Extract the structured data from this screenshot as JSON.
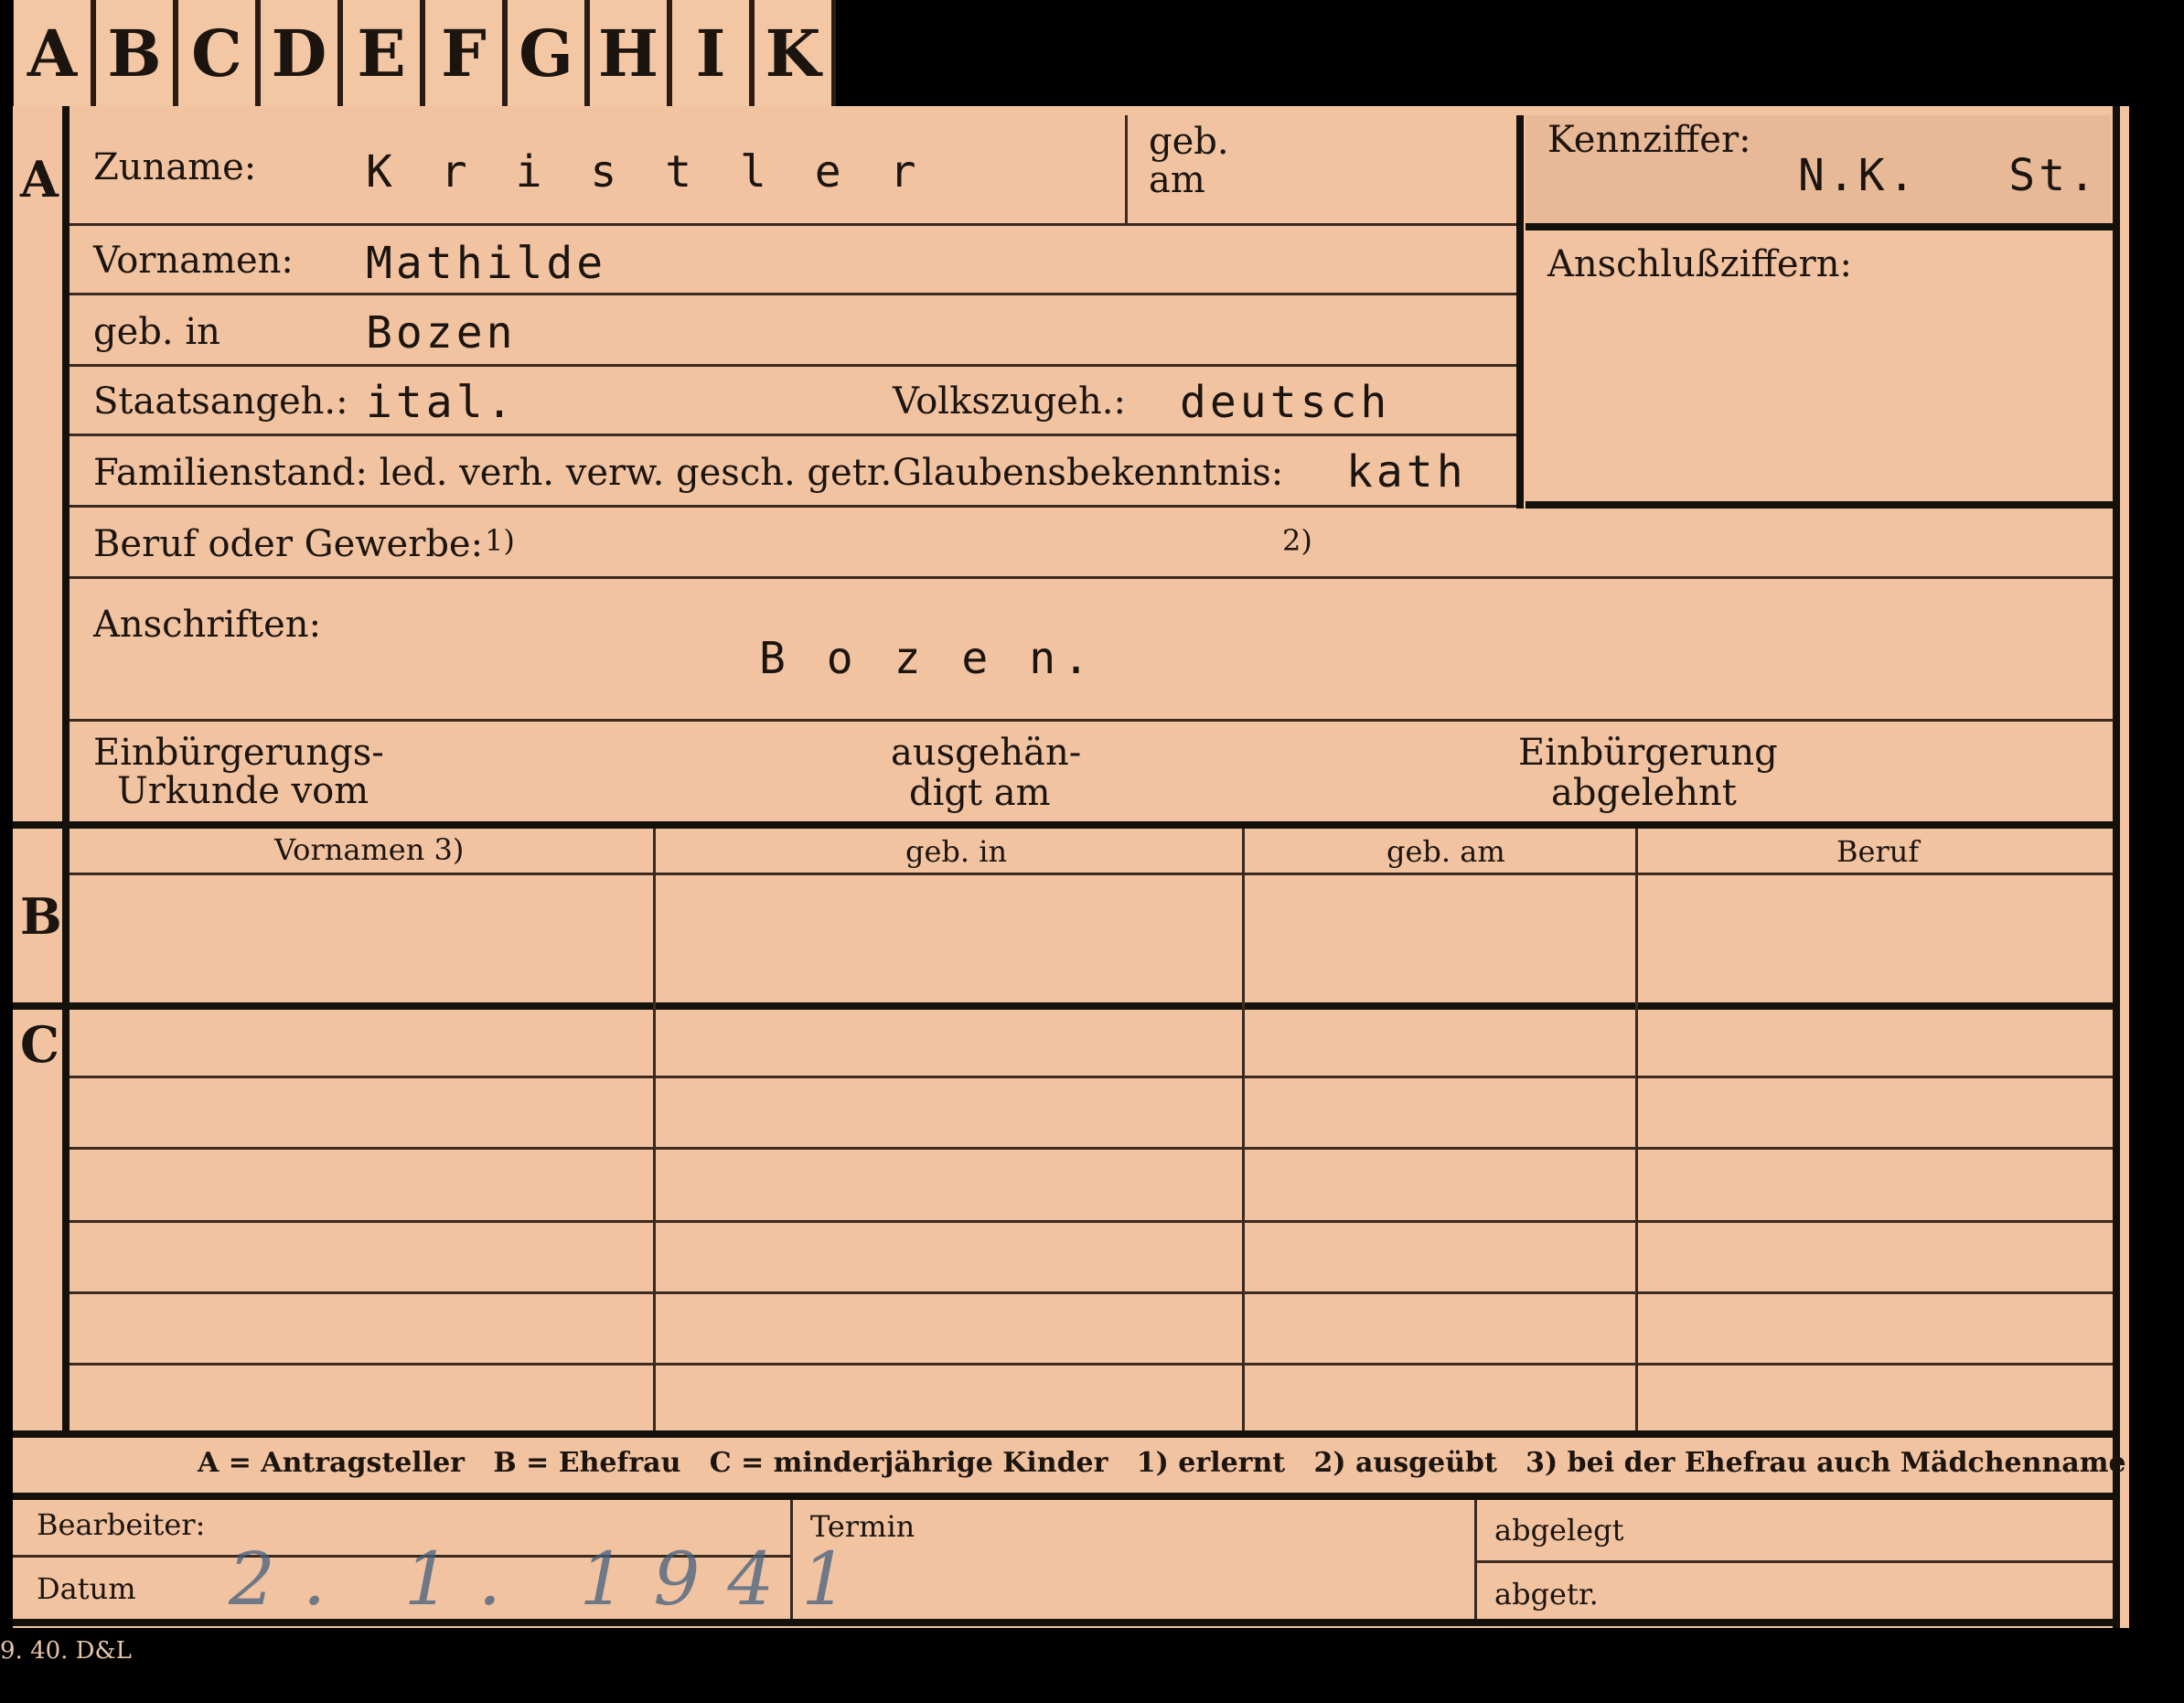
{
  "tabs": [
    "A",
    "B",
    "C",
    "D",
    "E",
    "F",
    "G",
    "H",
    "I",
    "K"
  ],
  "section_letters": {
    "a": "A",
    "b": "B",
    "c": "C"
  },
  "fields": {
    "zuname_label": "Zuname:",
    "zuname_value": "K r i s t l e r",
    "geb_am_label1": "geb.",
    "geb_am_label2": "am",
    "kennziffer_label": "Kennziffer:",
    "kennziffer_value": "N.K.   St.",
    "vornamen_label": "Vornamen:",
    "vornamen_value": "Mathilde",
    "anschlussziffern_label": "Anschlußziffern:",
    "geb_in_label": "geb. in",
    "geb_in_value": "Bozen",
    "staatsangeh_label": "Staatsangeh.:",
    "staatsangeh_value": "ital.",
    "volkszugeh_label": "Volkszugeh.:",
    "volkszugeh_value": "deutsch",
    "familienstand_label": "Familienstand: led. verh. verw. gesch. getr.",
    "glaubens_label": "Glaubensbekenntnis:",
    "glaubens_value": "kath",
    "beruf_label": "Beruf oder Gewerbe:",
    "beruf_fn1": "1)",
    "beruf_fn2": "2)",
    "anschriften_label": "Anschriften:",
    "anschriften_value": "B o z e n.",
    "einb_urkunde_1": "Einbürgerungs-",
    "einb_urkunde_2": "Urkunde vom",
    "ausgehaendigt_1": "ausgehän-",
    "ausgehaendigt_2": "digt am",
    "einb_abgelehnt_1": "Einbürgerung",
    "einb_abgelehnt_2": "abgelehnt"
  },
  "table_headers": [
    "Vornamen 3)",
    "geb. in",
    "geb. am",
    "Beruf"
  ],
  "legend": "A = Antragsteller   B = Ehefrau   C = minderjährige Kinder   1) erlernt   2) ausgeübt   3) bei der Ehefrau auch Mädchenname",
  "footer": {
    "bearbeiter_label": "Bearbeiter:",
    "datum_label": "Datum",
    "datum_value": "2. 1. 1941",
    "termin_label": "Termin",
    "abgelegt_label": "abgelegt",
    "abgetr_label": "abgetr."
  },
  "print_mark": "9. 40. D&L"
}
